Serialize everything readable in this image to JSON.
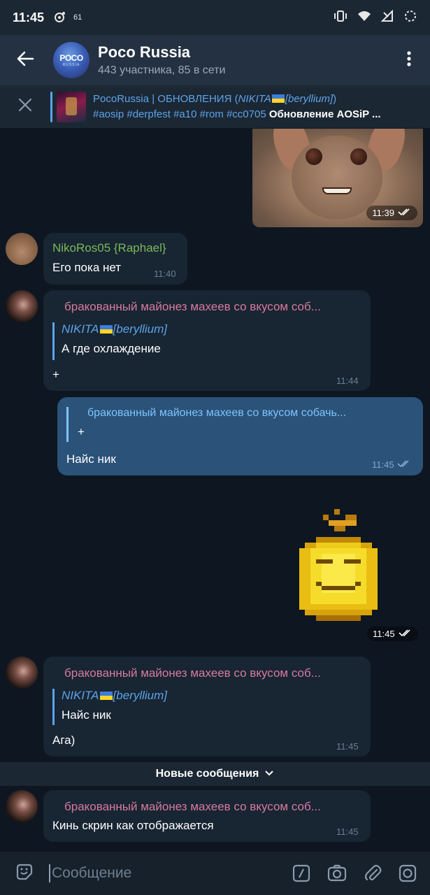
{
  "status_bar": {
    "time": "11:45",
    "notif_count": "61"
  },
  "header": {
    "avatar_line1": "POCO",
    "avatar_line2": "RUSSIA",
    "title": "Poco Russia",
    "subtitle": "443 участника, 85 в сети"
  },
  "pinned": {
    "title_prefix": "PocoRussia | ОБНОВЛЕНИЯ (",
    "title_user": "NIKITA",
    "title_tag": "[beryllium]",
    "title_suffix": ")",
    "body_tags": "#aosip #derpfest #a10 #rom #cc0705 ",
    "body_bold": "Обновление AOSiP ..."
  },
  "messages": {
    "photo_time": "11:39",
    "m1_sender": "NikoRos05 {Raphael}",
    "m1_text": "Его пока нет",
    "m1_time": "11:40",
    "m2_sender": "бракованный майонез махеев со вкусом соб...",
    "m2_reply_user": "NIKITA",
    "m2_reply_tag": "[beryllium]",
    "m2_reply_text": "А где охлаждение",
    "m2_text": "+",
    "m2_time": "11:44",
    "m3_reply_user": "бракованный майонез махеев со вкусом собачь...",
    "m3_reply_text": "+",
    "m3_text": "Найс ник",
    "m3_time": "11:45",
    "sticker_time": "11:45",
    "m4_sender": "бракованный майонез махеев со вкусом соб...",
    "m4_reply_user": "NIKITA",
    "m4_reply_tag": "[beryllium]",
    "m4_reply_text": "Найс ник",
    "m4_text": "Ага)",
    "m4_time": "11:45",
    "new_messages_label": "Новые сообщения",
    "m5_sender": "бракованный майонез махеев со вкусом соб...",
    "m5_text": "Кинь скрин как отображается",
    "m5_time": "11:45"
  },
  "input": {
    "placeholder": "Сообщение"
  },
  "colors": {
    "background": "#0e1621",
    "header": "#243142",
    "incoming_bubble": "#182533",
    "outgoing_bubble": "#2b5278",
    "accent": "#5ca4e8",
    "sender_green": "#7ab958",
    "sender_pink": "#d77a9d"
  }
}
